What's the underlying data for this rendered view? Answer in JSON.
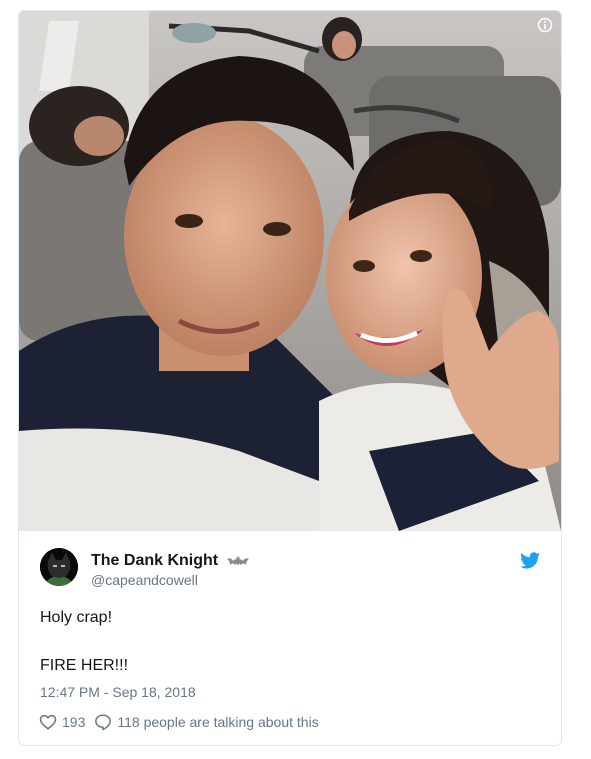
{
  "tweet": {
    "display_name": "The Dank Knight",
    "handle": "@capeandcowell",
    "text_line_1": "Holy crap!",
    "text_line_2": "FIRE HER!!!",
    "timestamp": "12:47 PM - Sep 18, 2018",
    "likes": "193",
    "replies_text": "118 people are talking about this"
  },
  "icons": {
    "info": "info-icon",
    "bird": "twitter-bird-icon",
    "heart": "heart-icon",
    "comment": "comment-icon",
    "badge": "bat-icon"
  },
  "colors": {
    "twitter_blue": "#1da1f2",
    "text": "#14171a",
    "muted": "#657786",
    "border": "#e1e8ed"
  }
}
